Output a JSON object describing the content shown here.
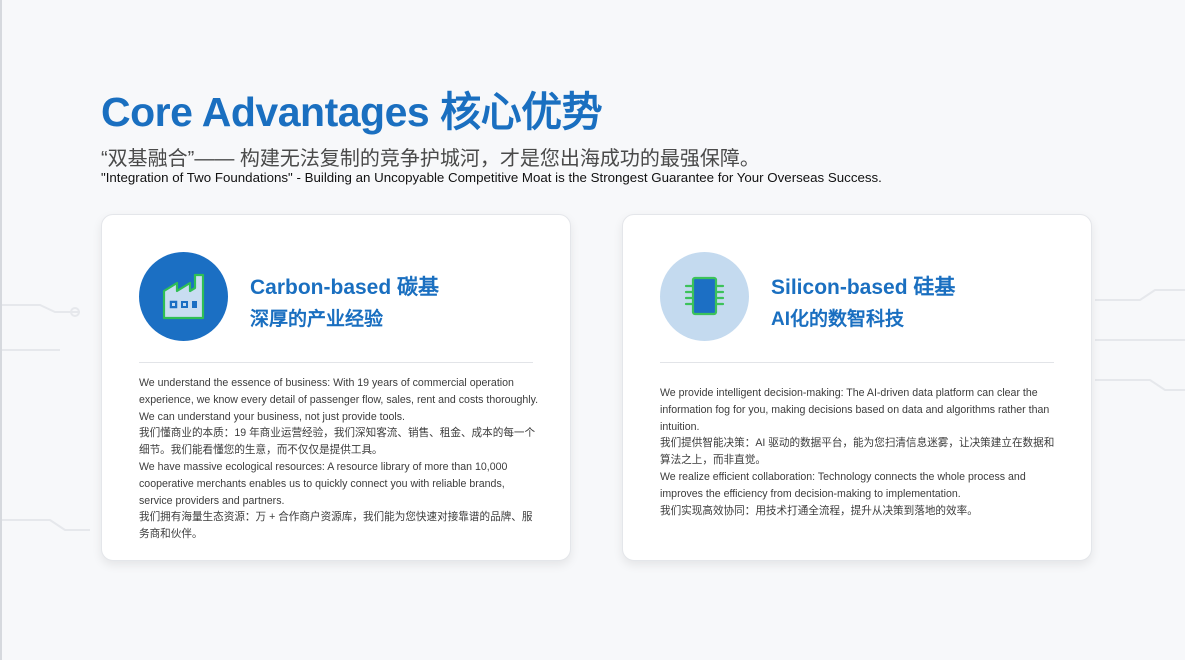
{
  "title": "Core Advantages 核心优势",
  "subtitle_cn": "“双基融合”—— 构建无法复制的竞争护城河，才是您出海成功的最强保障。",
  "subtitle_en": "\"Integration of Two Foundations\" - Building an Uncopyable Competitive Moat is the Strongest Guarantee for Your Overseas Success.",
  "cards": [
    {
      "icon": "factory-icon",
      "heading_en": "Carbon-based 碳基",
      "heading_cn": "深厚的产业经验",
      "paragraphs": [
        "We understand the essence of business: With 19 years of commercial operation experience, we know every detail of passenger flow, sales, rent and costs thoroughly. We can understand your business, not just provide tools.",
        "我们懂商业的本质：19 年商业运营经验，我们深知客流、销售、租金、成本的每一个细节。我们能看懂您的生意，而不仅仅是提供工具。",
        "We have massive ecological resources: A resource library of more than 10,000 cooperative merchants enables us to quickly connect you with reliable brands, service providers and partners.",
        "我们拥有海量生态资源：万 + 合作商户资源库，我们能为您快速对接靠谱的品牌、服务商和伙伴。"
      ]
    },
    {
      "icon": "chip-icon",
      "heading_en": "Silicon-based 硅基",
      "heading_cn": "AI化的数智科技",
      "paragraphs": [
        "We provide intelligent decision-making: The AI-driven data platform can clear the information fog for you, making decisions based on data and algorithms rather than intuition.",
        "我们提供智能决策：AI 驱动的数据平台，能为您扫清信息迷雾，让决策建立在数据和算法之上，而非直觉。",
        "We realize efficient collaboration: Technology connects the whole process and improves the efficiency from decision-making to implementation.",
        "我们实现高效协同：用技术打通全流程，提升从决策到落地的效率。"
      ]
    }
  ],
  "colors": {
    "accent": "#1a6fc0",
    "badge_dark": "#1b6fc3",
    "badge_light": "#c4daef",
    "chip_green": "#3cc25a",
    "chip_body": "#1c6fc4"
  }
}
